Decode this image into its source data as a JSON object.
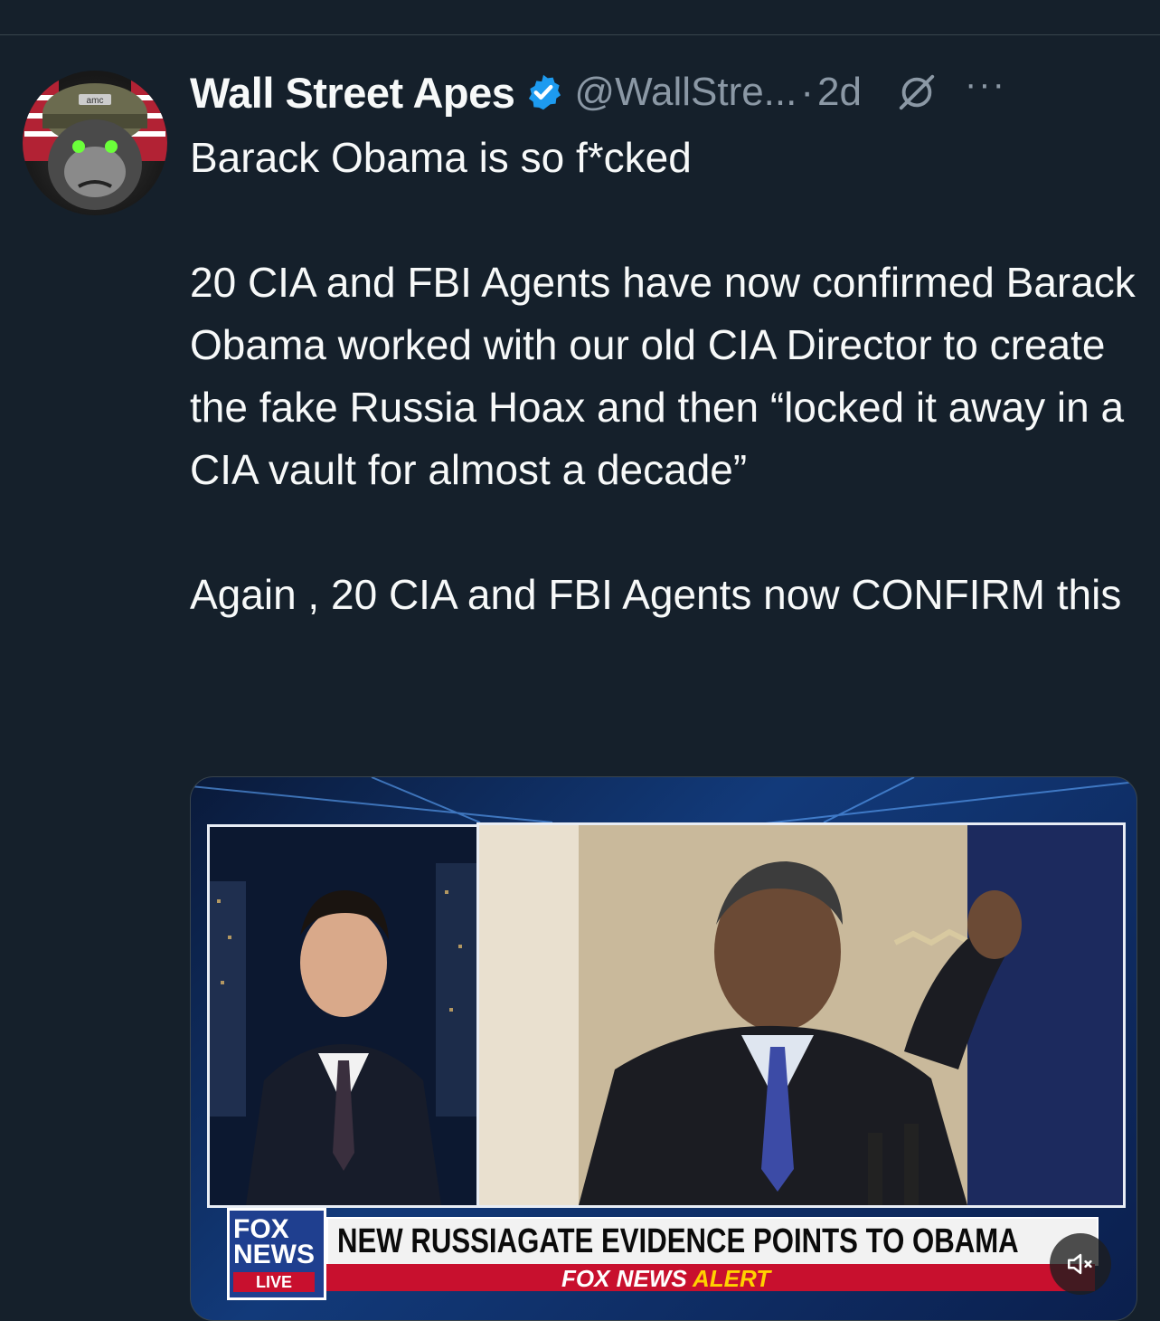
{
  "tweet": {
    "display_name": "Wall Street Apes",
    "handle": "@WallStre...",
    "separator": "·",
    "time": "2d",
    "more_label": "···",
    "text": "Barack Obama is so f*cked\n\n20 CIA and FBI Agents have now confirmed Barack Obama worked with our old CIA Director to create the fake Russia Hoax and then “locked it away in a CIA vault for almost a decade”\n\nAgain , 20 CIA and FBI Agents now CONFIRM this"
  },
  "avatar": {
    "badge_text": "amc"
  },
  "media": {
    "logo_fox": "FOX",
    "logo_news": "NEWS",
    "logo_live": "LIVE",
    "headline": "NEW RUSSIAGATE EVIDENCE POINTS TO OBAMA",
    "alert_prefix": "FOX NEWS",
    "alert_word": "ALERT"
  },
  "colors": {
    "background": "#15202b",
    "text_primary": "#f7f9f9",
    "text_secondary": "#8b98a5",
    "verified": "#1d9bf0",
    "fox_red": "#c8102e",
    "fox_blue": "#1f3f8f"
  },
  "icons": [
    "verified-badge-icon",
    "grok-icon",
    "more-icon",
    "mute-icon"
  ]
}
